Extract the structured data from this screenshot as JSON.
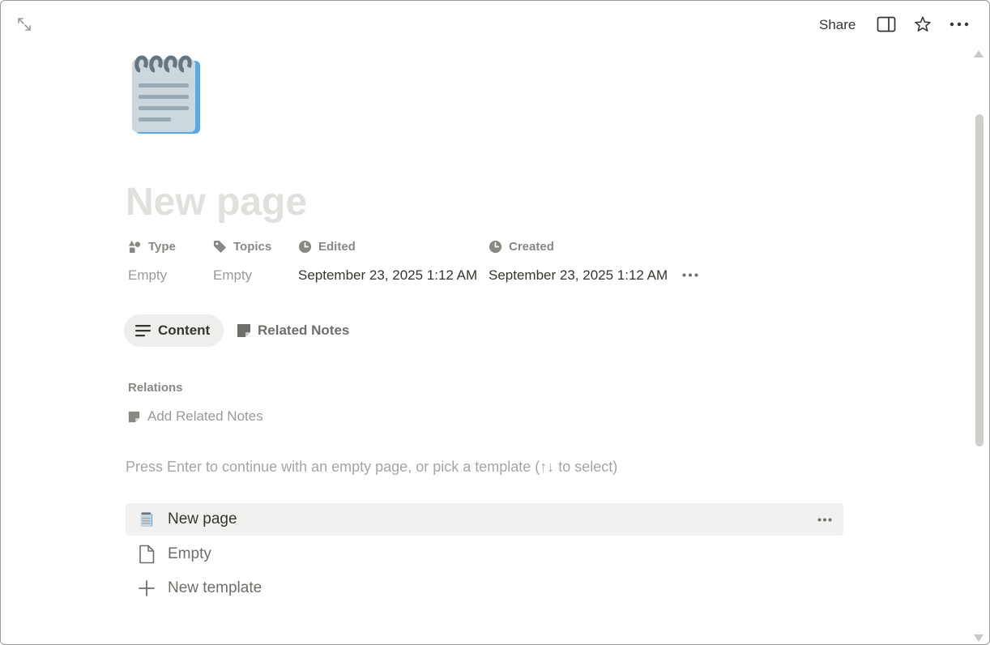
{
  "topbar": {
    "share_label": "Share"
  },
  "page": {
    "icon": "notepad-icon",
    "title": "New page"
  },
  "properties": [
    {
      "name": "Type",
      "icon": "shapes-icon",
      "value": "Empty",
      "empty": true
    },
    {
      "name": "Topics",
      "icon": "tag-icon",
      "value": "Empty",
      "empty": true
    },
    {
      "name": "Edited",
      "icon": "clock-icon",
      "value": "September 23, 2025 1:12 AM",
      "empty": false
    },
    {
      "name": "Created",
      "icon": "clock-icon",
      "value": "September 23, 2025 1:12 AM",
      "empty": false
    }
  ],
  "tabs": [
    {
      "label": "Content",
      "icon": "lines-icon",
      "active": true
    },
    {
      "label": "Related Notes",
      "icon": "note-icon",
      "active": false
    }
  ],
  "relations": {
    "heading": "Relations",
    "add_label": "Add Related Notes"
  },
  "template_hint": "Press Enter to continue with an empty page, or pick a template (↑↓ to select)",
  "templates": [
    {
      "label": "New page",
      "icon": "notepad-icon",
      "highlighted": true
    },
    {
      "label": "Empty",
      "icon": "document-icon",
      "highlighted": false
    },
    {
      "label": "New template",
      "icon": "plus-icon",
      "highlighted": false
    }
  ],
  "colors": {
    "text": "#37352f",
    "muted": "#9b9a97",
    "title_placeholder": "#e1e0dd",
    "tab_active_bg": "#efeeec",
    "row_highlight_bg": "#f1f1ef",
    "notepad_blue": "#5aa9e6"
  }
}
